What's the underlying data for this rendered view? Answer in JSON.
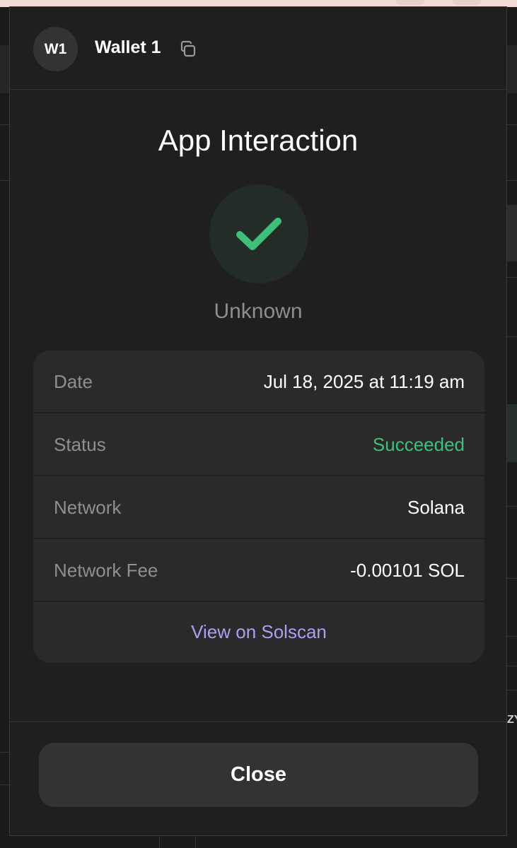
{
  "header": {
    "avatar_initials": "W1",
    "wallet_name": "Wallet 1",
    "copy_icon": "copy-icon"
  },
  "main": {
    "title": "App Interaction",
    "status_icon": "checkmark-icon",
    "subtitle": "Unknown"
  },
  "details": {
    "rows": [
      {
        "label": "Date",
        "value": "Jul 18, 2025 at 11:19 am"
      },
      {
        "label": "Status",
        "value": "Succeeded"
      },
      {
        "label": "Network",
        "value": "Solana"
      },
      {
        "label": "Network Fee",
        "value": "-0.00101 SOL"
      }
    ],
    "link_label": "View on Solscan"
  },
  "footer": {
    "close_label": "Close"
  },
  "colors": {
    "success": "#3fbf7a",
    "link": "#ab9ff2",
    "background": "#1f1f1f",
    "card": "#2a2a2a"
  }
}
